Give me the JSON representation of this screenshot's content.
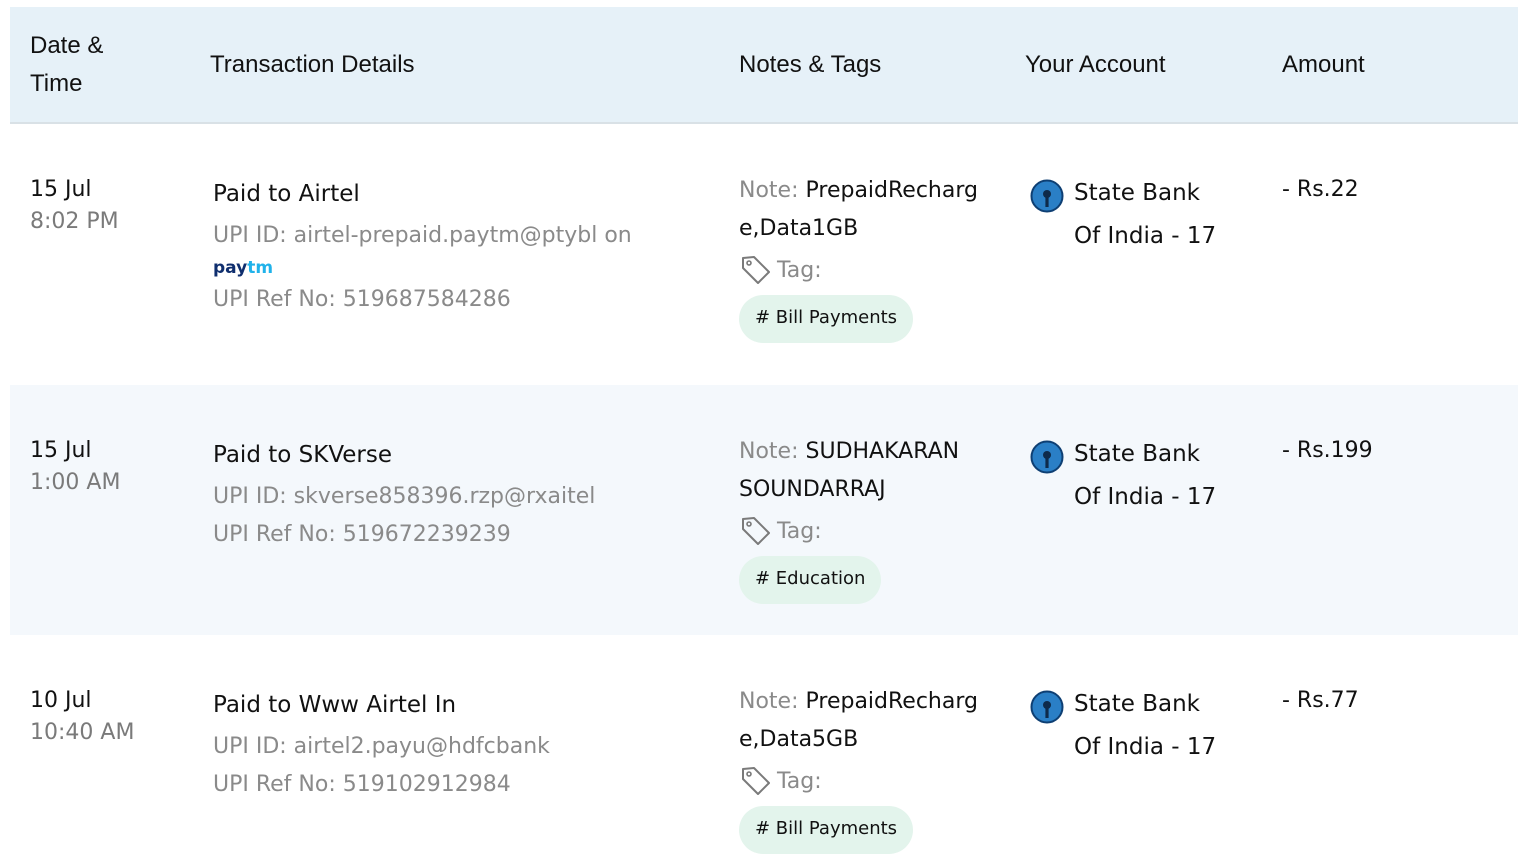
{
  "header": {
    "date_time": "Date &\nTime",
    "details": "Transaction Details",
    "notes": "Notes & Tags",
    "account": "Your Account",
    "amount": "Amount"
  },
  "labels": {
    "note": "Note:",
    "tag": "Tag:"
  },
  "colors": {
    "header_bg": "#e6f1f8",
    "alt_row_bg": "#f4f8fc",
    "tag_bg": "#e3f4ec",
    "sbi_blue": "#2a7fc6"
  },
  "transactions": [
    {
      "date": "15 Jul",
      "time": "8:02 PM",
      "title": "Paid to Airtel",
      "upi_id": "UPI ID: airtel-prepaid.paytm@ptybl on",
      "app_logo": {
        "part1": "pay",
        "part2": "tm"
      },
      "ref": "UPI Ref No: 519687584286",
      "note": "PrepaidRecharge,Data1GB",
      "tag": "# Bill Payments",
      "account_line1": "State Bank",
      "account_line2": "Of India - 17",
      "amount": "- Rs.22"
    },
    {
      "date": "15 Jul",
      "time": "1:00 AM",
      "title": "Paid to SKVerse",
      "upi_id": "UPI ID: skverse858396.rzp@rxaitel",
      "ref": "UPI Ref No: 519672239239",
      "note": "SUDHAKARAN SOUNDARRAJ",
      "tag": "# Education",
      "account_line1": "State Bank",
      "account_line2": "Of India - 17",
      "amount": "- Rs.199"
    },
    {
      "date": "10 Jul",
      "time": "10:40 AM",
      "title": "Paid to Www Airtel In",
      "upi_id": "UPI ID: airtel2.payu@hdfcbank",
      "ref": "UPI Ref No: 519102912984",
      "note": "PrepaidRecharge,Data5GB",
      "tag": "# Bill Payments",
      "account_line1": "State Bank",
      "account_line2": "Of India - 17",
      "amount": "- Rs.77"
    }
  ]
}
